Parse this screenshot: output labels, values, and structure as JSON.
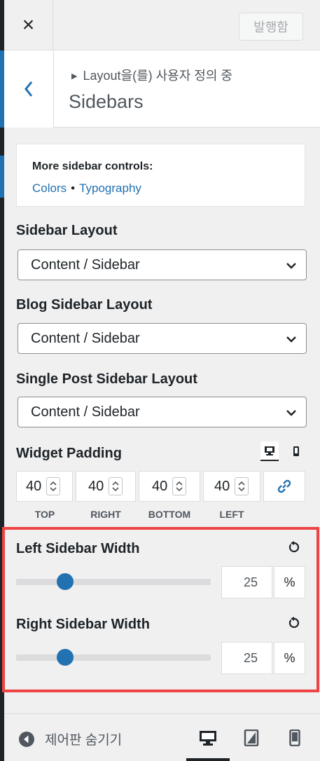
{
  "header": {
    "close_glyph": "×",
    "publish_label": "발행함"
  },
  "section": {
    "breadcrumb": "Layout을(를) 사용자 정의 중",
    "title": "Sidebars"
  },
  "more_controls": {
    "title": "More sidebar controls:",
    "links": [
      "Colors",
      "Typography"
    ],
    "separator": "•"
  },
  "controls": {
    "sidebar_layout": {
      "label": "Sidebar Layout",
      "value": "Content / Sidebar"
    },
    "blog_sidebar_layout": {
      "label": "Blog Sidebar Layout",
      "value": "Content / Sidebar"
    },
    "single_post_sidebar_layout": {
      "label": "Single Post Sidebar Layout",
      "value": "Content / Sidebar"
    }
  },
  "widget_padding": {
    "label": "Widget Padding",
    "values": [
      "40",
      "40",
      "40",
      "40"
    ],
    "sides": [
      "TOP",
      "RIGHT",
      "BOTTOM",
      "LEFT"
    ]
  },
  "left_sidebar_width": {
    "label": "Left Sidebar Width",
    "value": "25",
    "unit": "%",
    "slider_fraction": 0.25
  },
  "right_sidebar_width": {
    "label": "Right Sidebar Width",
    "value": "25",
    "unit": "%",
    "slider_fraction": 0.25
  },
  "footer": {
    "hide_controls_label": "제어판 숨기기"
  },
  "icons": {
    "close": "close-icon",
    "back": "chevron-left-icon",
    "chevron": "chevron-down-icon",
    "desktop": "desktop-icon",
    "tablet": "tablet-icon",
    "mobile": "mobile-icon",
    "link": "link-icon",
    "reset": "reset-icon",
    "collapse": "arrow-left-circle-icon"
  },
  "colors": {
    "accent": "#2271b1",
    "highlight": "#ee4444"
  }
}
